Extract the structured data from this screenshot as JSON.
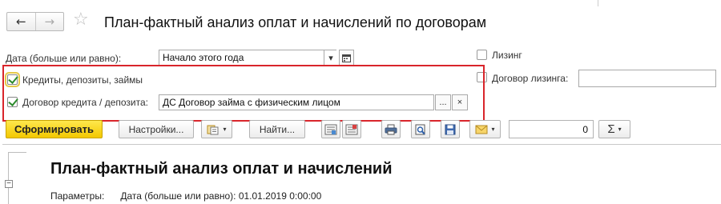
{
  "window": {
    "title": "План-фактный анализ оплат и начислений по договорам",
    "nav_back": "←",
    "nav_forward": "→",
    "favorite": "☆"
  },
  "form": {
    "date_label": "Дата (больше или равно):",
    "date_value": "Начало этого года",
    "leasing_label": "Лизинг",
    "leasing_checked": false,
    "credits_label": "Кредиты, депозиты, займы",
    "credits_checked": true,
    "leasing_contract_label": "Договор лизинга:",
    "leasing_contract_value": "",
    "credit_contract_label": "Договор кредита / депозита:",
    "credit_contract_checked": true,
    "credit_contract_value": "ДС Договор займа с физическим лицом",
    "select_btn": "...",
    "clear_btn": "×",
    "dropdown_btn": "▾"
  },
  "toolbar": {
    "generate": "Сформировать",
    "settings": "Настройки...",
    "find": "Найти...",
    "number_value": "0",
    "sum_symbol": "Σ"
  },
  "report": {
    "title": "План-фактный анализ оплат и начислений",
    "params_label": "Параметры:",
    "params_value": "Дата (больше или равно): 01.01.2019 0:00:00",
    "collapse_symbol": "−"
  },
  "colors": {
    "highlight_frame": "#d9252b",
    "primary_button": "#f3c800",
    "check": "#2e8b2e"
  }
}
